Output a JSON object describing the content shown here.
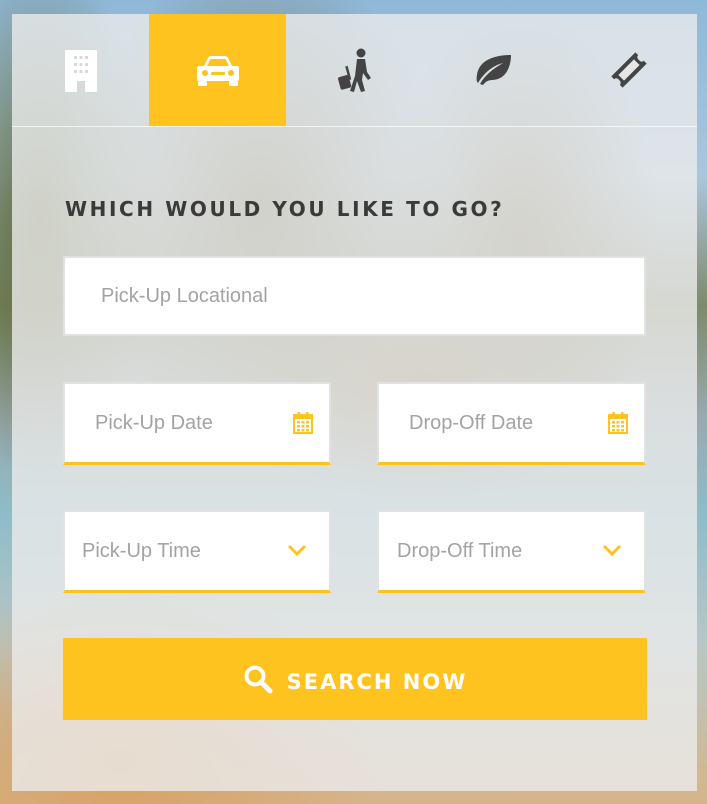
{
  "tabs": [
    {
      "icon": "hotel-building-icon"
    },
    {
      "icon": "car-icon",
      "active": true
    },
    {
      "icon": "traveler-luggage-icon"
    },
    {
      "icon": "leaf-icon"
    },
    {
      "icon": "ticket-icon"
    }
  ],
  "form": {
    "heading": "WHICH WOULD YOU LIKE TO GO?",
    "pickup_location": {
      "placeholder": "Pick-Up Locational"
    },
    "pickup_date": {
      "placeholder": "Pick-Up Date",
      "icon": "calendar-icon"
    },
    "dropoff_date": {
      "placeholder": "Drop-Off Date",
      "icon": "calendar-icon"
    },
    "pickup_time": {
      "placeholder": "Pick-Up Time",
      "icon": "chevron-down-icon"
    },
    "dropoff_time": {
      "placeholder": "Drop-Off Time",
      "icon": "chevron-down-icon"
    },
    "search_button": {
      "label": "SEARCH NOW",
      "icon": "search-icon"
    }
  },
  "colors": {
    "accent": "#ffc31f",
    "heading": "#3a3a3a",
    "placeholder": "#a3a3a3",
    "icon_dark": "#444444"
  }
}
